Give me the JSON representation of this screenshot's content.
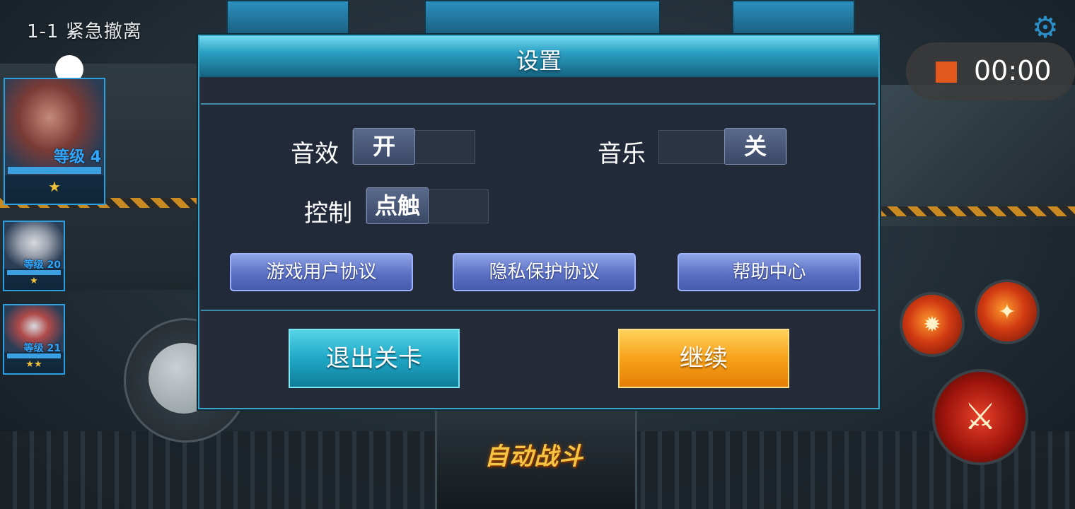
{
  "hud": {
    "level_title": "1-1  紧急撤离",
    "gear_icon": "gear-icon",
    "record_time": "00:00",
    "auto_battle_label": "自动战斗"
  },
  "heroes": [
    {
      "level": "等级 4",
      "stars": "★"
    },
    {
      "level": "等级 20",
      "stars": "★"
    },
    {
      "level": "等级 21",
      "stars": "★★"
    }
  ],
  "settings": {
    "title": "设置",
    "sound_label": "音效",
    "sound_value": "开",
    "music_label": "音乐",
    "music_value": "关",
    "control_label": "控制",
    "control_value": "点触",
    "user_agreement": "游戏用户协议",
    "privacy_agreement": "隐私保护协议",
    "help_center": "帮助中心",
    "exit_label": "退出关卡",
    "continue_label": "继续"
  },
  "colors": {
    "accent_cyan": "#2aa0c3",
    "record_stop": "#e2571b",
    "continue_orange": "#f7a21a"
  }
}
